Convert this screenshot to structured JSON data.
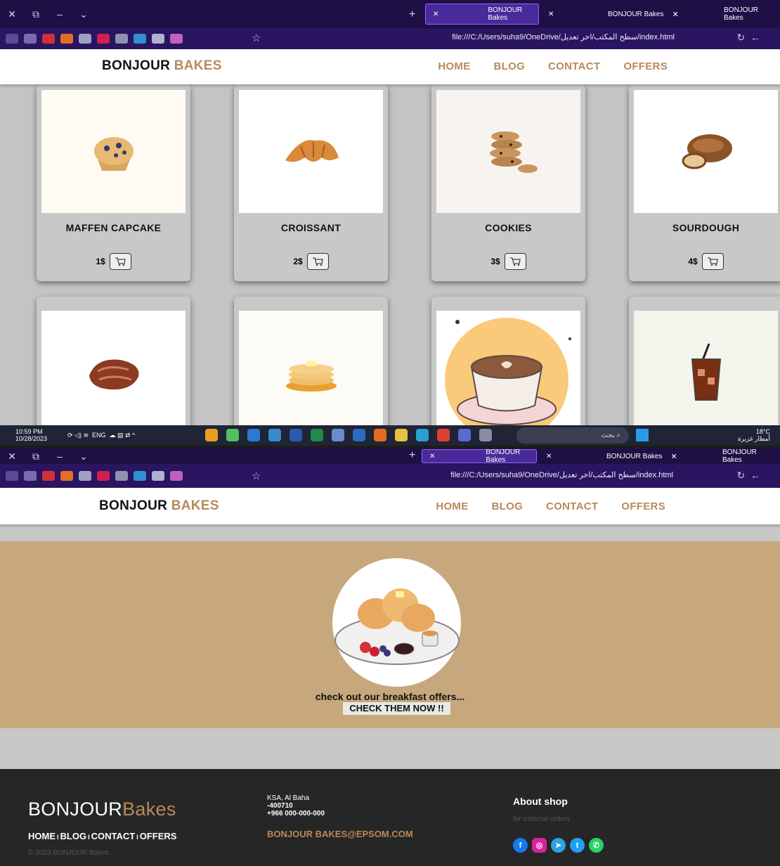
{
  "browser": {
    "tabs": [
      {
        "label": "BONJOUR Bakes",
        "active": true
      },
      {
        "label": "BONJOUR Bakes",
        "active": false
      },
      {
        "label": "BONJOUR Bakes",
        "active": false
      }
    ],
    "url": "file:///C:/Users/suha9/OneDrive/سطح المكتب/اخر تعديل/index.html"
  },
  "site": {
    "logo_main": "BONJOUR",
    "logo_accent": "BAKES",
    "nav": [
      "HOME",
      "BLOG",
      "CONTACT",
      "OFFERS"
    ]
  },
  "products": [
    {
      "name": "MAFFEN CAPCAKE",
      "price": "1$",
      "icon": "muffin-icon"
    },
    {
      "name": "CROISSANT",
      "price": "2$",
      "icon": "croissant-icon"
    },
    {
      "name": "COOKIES",
      "price": "3$",
      "icon": "cookies-icon"
    },
    {
      "name": "SOURDOUGH",
      "price": "4$",
      "icon": "bread-icon"
    },
    {
      "name": "",
      "price": "",
      "icon": "pastry-icon"
    },
    {
      "name": "",
      "price": "",
      "icon": "pancakes-icon"
    },
    {
      "name": "",
      "price": "",
      "icon": "coffee-icon"
    },
    {
      "name": "",
      "price": "",
      "icon": "iced-drink-icon"
    }
  ],
  "taskbar": {
    "time": "10:59 PM",
    "date": "10/28/2023",
    "lang": "ENG",
    "search_placeholder": "بحث",
    "temp": "18°C",
    "weather": "أمطار غزيرة"
  },
  "offer": {
    "tagline": "check out our breakfast offers...",
    "cta": "CHECK THEM NOW !!"
  },
  "footer": {
    "logo_main": "BONJOUR",
    "logo_light": "Bakes",
    "links": [
      "HOME",
      "BLOG",
      "CONTACT",
      "OFFERS"
    ],
    "copyright": "© 2023 BONJOUR Bakes .",
    "address": "KSA, Al Baha",
    "postal": "-400710",
    "phone": "+966 000-000-000",
    "email": "BONJOUR BAKES@EPSOM.COM",
    "about_title": "About shop",
    "about_sub": "for external orders"
  },
  "colors": {
    "accent": "#b9895a",
    "offer_bg": "#c6a87c",
    "footer_bg": "#262626",
    "browser_bg": "#1e0f45"
  }
}
